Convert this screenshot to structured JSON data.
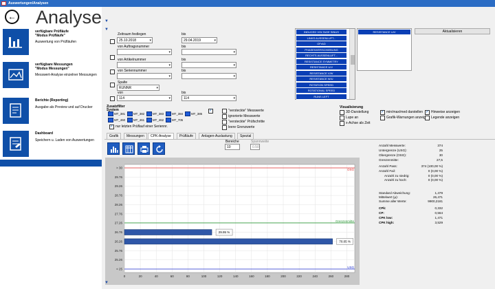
{
  "window": {
    "title": "Auswertungen/Analysen"
  },
  "app": {
    "title": "Analyse"
  },
  "sidebar": {
    "items": [
      {
        "title": "verfügbare Prüfläufe",
        "subtitle": "\"Modus Prüfläufe\"",
        "desc": "Auswertung von Prüfläufen",
        "icon": "bar-chart-icon"
      },
      {
        "title": "verfügbare Messungen",
        "subtitle": "\"Modus Messungen\"",
        "desc": "Messwert-Analyse einzelner Messungen",
        "icon": "image-icon"
      },
      {
        "title": "Berichte (Reporting)",
        "subtitle": "",
        "desc": "Ausgabe als Preview und auf Drucker",
        "icon": "report-icon"
      },
      {
        "title": "Dashboard",
        "subtitle": "",
        "desc": "Speichern u. Laden von Auswertungen",
        "icon": "dashboard-icon"
      }
    ]
  },
  "filters": {
    "time_label": "Zeitraum festlegen",
    "bis": "bis",
    "date_from": "25.10.2018",
    "date_to": "29.04.2019",
    "auftrag_label": "von Auftragsnummer",
    "artikel_label": "von Artikelnummer",
    "serien_label": "von Seriennummer",
    "spalte_label": "Spalte",
    "spalte_value": "RUNNR",
    "von": "von",
    "von_value": "114",
    "bis_value": "114"
  },
  "measurements": [
    "INDUCED VOLTAGE SINUS",
    "LINKS AUSSENLUFT...",
    "OFrAD",
    "PHASENVERSCHIEBUNG",
    "RECHTS AUSSENLUFT...",
    "RESISTANCE SYMMETRY",
    "RESISTANCE U/V",
    "RESISTANCE V/W",
    "RESISTANCE W/U",
    "ROTATION SPEED",
    "ROTATIONAL SPEED",
    "RUNS LEFT"
  ],
  "selected_measurement": "RESISTANCE U/V",
  "refresh_button": "Aktualisieren",
  "zusatzfilter": {
    "label": "Zusatzfilter",
    "system_label": "System",
    "systems": [
      "MT_381",
      "MT_382",
      "MT_383",
      "MT_384",
      "MT_385",
      "MT_460",
      "MT_461",
      "MT_462",
      "MT_705"
    ],
    "last_run_only": "nur letzten Prüflauf einer Seriennr."
  },
  "options": {
    "hidden_values": "\"versteckte\" Messwerte",
    "ignored_values": "ignorierte Messwerte",
    "hidden_steps": "\"versteckte\" Prüfschritte",
    "empty_limits": "leere Grenzwerte"
  },
  "visualisierung": {
    "label": "Visualisierung",
    "items": [
      {
        "label": "3D-Darstellung",
        "checked": false
      },
      {
        "label": "Lupe an",
        "checked": false
      },
      {
        "label": "x-Achse als Zeit",
        "checked": false
      },
      {
        "label": "min/max/med darstellen",
        "checked": true
      },
      {
        "label": "Grafik-Warnungen anzeigen",
        "checked": false
      },
      {
        "label": "Hinweise anzeigen",
        "checked": true
      },
      {
        "label": "Legende anzeigen",
        "checked": false
      }
    ]
  },
  "tabs": [
    "Grafik",
    "Messungen",
    "CPK-Analyse",
    "Prüfläufe",
    "Anlagen-Auslastung",
    "Spezial"
  ],
  "active_tab": "CPK-Analyse",
  "bereiche": {
    "label": "Bereiche",
    "value": "10"
  },
  "spannweite": {
    "label": "Spannweite",
    "value": "0.50"
  },
  "toolbar": {
    "icons": [
      "histogram-icon",
      "table-icon",
      "print-icon",
      "refresh-icon"
    ]
  },
  "stats": [
    {
      "label": "Anzahl Messwerte:",
      "value": "374"
    },
    {
      "label": "Untergrenze (USG):",
      "value": "25"
    },
    {
      "label": "Obergrenze (OSG):",
      "value": "30"
    },
    {
      "label": "Grenzenmitte:",
      "value": "27,5"
    },
    {
      "label": "Anzahl Pass:",
      "value": "374   (100,00 %)"
    },
    {
      "label": "Anzahl Fail:",
      "value": "0      (0,00 %)"
    },
    {
      "label": "Anzahl  zu niedrig:",
      "value": "0      (0,00 %)"
    },
    {
      "label": "Anzahl  zu hoch:",
      "value": "0      (0,00 %)"
    },
    {
      "label": "Standard Abweichung:",
      "value": "1,479"
    },
    {
      "label": "Mittelwert (µ):",
      "value": "26,471"
    },
    {
      "label": "Summe aller Werte:",
      "value": "9900,2181"
    },
    {
      "label": "CPk:",
      "value": "0,332"
    },
    {
      "label": "CP:",
      "value": "0,564"
    },
    {
      "label": "CPK low:",
      "value": "1,471"
    },
    {
      "label": "CPK high:",
      "value": "3,529"
    }
  ],
  "chart_data": {
    "type": "bar",
    "orientation": "horizontal",
    "y_ticks": [
      "> 30",
      "29.76",
      "29.26",
      "28.76",
      "28.26",
      "27.76",
      "27.26",
      "26.76",
      "26.26",
      "25.76",
      "25.26",
      "< 25"
    ],
    "x_ticks": [
      0,
      20,
      40,
      60,
      80,
      100,
      120,
      140,
      160,
      180,
      200,
      220,
      240,
      260,
      280
    ],
    "xlim": [
      0,
      290
    ],
    "bars": [
      {
        "category": "26.76",
        "value": 110,
        "label": "29.95 %"
      },
      {
        "category": "26.26",
        "value": 262,
        "label": "70.05 %"
      }
    ],
    "lines": [
      {
        "name": "OSG",
        "at": "> 30",
        "color": "#e03030"
      },
      {
        "name": "Grenzenmitte",
        "at": "27.50",
        "color": "#2f9a3a"
      },
      {
        "name": "USG",
        "at": "< 25",
        "color": "#2030d0"
      }
    ],
    "grid": true
  }
}
